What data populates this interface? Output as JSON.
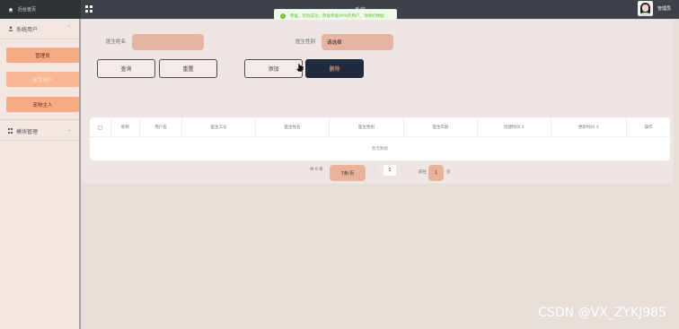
{
  "header": {
    "home_label": "后台首页",
    "system_title": "系统",
    "user_name": "管理员"
  },
  "toast": {
    "message": "恭喜，检验成功，恭喜恭喜99%的用户，请按好数据"
  },
  "sidebar": {
    "group1_label": "系统用户",
    "items": [
      {
        "label": "管理员"
      },
      {
        "label": "医生用户"
      },
      {
        "label": "宠物主人"
      }
    ],
    "group2_label": "模块管理"
  },
  "filters": {
    "doctor_name_label": "医生姓名",
    "doctor_name_value": "",
    "doctor_gender_label": "医生性别",
    "doctor_gender_value": "请选择"
  },
  "buttons": {
    "query": "查询",
    "reset": "重置",
    "add": "添加",
    "delete": "删除"
  },
  "table": {
    "columns": [
      "",
      "昵称",
      "用户名",
      "医生工号",
      "医生姓名",
      "医生性别",
      "医生年龄",
      "创建时间 ⇕",
      "更新时间 ⇕",
      "操作"
    ],
    "empty_text": "暂无数据"
  },
  "pagination": {
    "total": "共 0 条",
    "page_size": "7条/页",
    "prev": "‹",
    "current": "1",
    "next": "›",
    "goto_label": "前往",
    "goto_value": "1",
    "page_suffix": "页"
  },
  "watermark": "CSDN @VX_ZYKJ985",
  "colors": {
    "topbar": "#3e4147",
    "sidebar": "#f2e7e3",
    "accent": "#f6ab84",
    "dark_button": "#1f2b3d"
  }
}
